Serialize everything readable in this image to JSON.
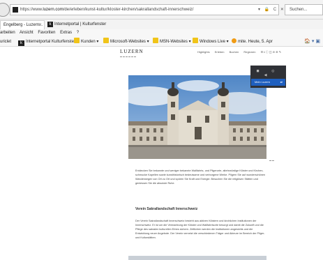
{
  "browser": {
    "address": {
      "url_prefix": "https://www.",
      "url_domain": "luzern.com",
      "url_path": "/de/erleben/kunst-kultur/kloster-kirchen/sakrallandschaft-innerschweiz/",
      "controls": "▾ 🔒 C ✕",
      "search_placeholder": "Suchen..."
    },
    "tabs": [
      {
        "label": "Engelberg - Luzern...",
        "close": "✕"
      },
      {
        "icon_text": "k",
        "label": "Internetportal | Kulturfenster"
      }
    ],
    "menu": [
      "arbeiten",
      "Ansicht",
      "Favoriten",
      "Extras",
      "?"
    ],
    "favorites": [
      {
        "label": "uriclet",
        "icon": "none"
      },
      {
        "label": "Internetportal Kulturfenster",
        "icon": "k-icon"
      },
      {
        "label": "Kunden ▾",
        "icon": "folder-icon"
      },
      {
        "label": "Microsoft-Websites ▾",
        "icon": "folder-icon"
      },
      {
        "label": "MSN-Websites ▾",
        "icon": "folder-icon"
      },
      {
        "label": "Windows Live ▾",
        "icon": "folder-icon"
      },
      {
        "label": "mite. Heute, 5. Apr",
        "icon": "orange-dot"
      }
    ],
    "fav_right": "🏠 ▾ ▣"
  },
  "page": {
    "logo": "LUZERN",
    "nav": [
      "Highlights",
      "Erleben",
      "Buchen",
      "Regionen"
    ],
    "nav_icons": "☰ ⭳ ⓘ ◫ ⊘ ⊕ ✎",
    "dropdown": {
      "icons": "◼ ◎ ◀",
      "item_label": "Mein Luzern",
      "item_icon": "⇄"
    },
    "section_title": "Verein Sakrallandschaft Innerschweiz",
    "paragraph_1": "Entdecken Sie bekannte und weniger bekannte Wallfahrts- und Pilgerorte, altehrwürdige Klöster und Kirchen, schmucke Kapellen sowie kunsthistorisch bedeutsame und verborgene Werke. Pilgern Sie auf wunderschönen Wanderwegen von Ort zu Ort und spüren Sie Kraft und Energie. Besuchen Sie die religiösen Stätten und geniessen Sie die absolute Ruhe.",
    "paragraph_2": "Der Verein Sakrallandschaft Innerschweiz besteht aus aktiven Klöstern und kirchlichen Institutionen der Innerschweiz. Er ist um die Vermarktung der Klöster und Wallfahrtsorte besorgt und damit die Zukunft und die Pflege des sakralen kulturellen Erbes sichern. Zeitlichen werden die Institutionen angesichts und die Entwicklung neuer Angebote. Der Verein vernetzt die verschiedenen Träger und Akteure im Bereich der Pilger- und Kulturstätten."
  },
  "colors": {
    "dark_panel": "#2f3136",
    "accent_blue": "#1f5fbf",
    "folder_yellow": "#f0c419"
  }
}
